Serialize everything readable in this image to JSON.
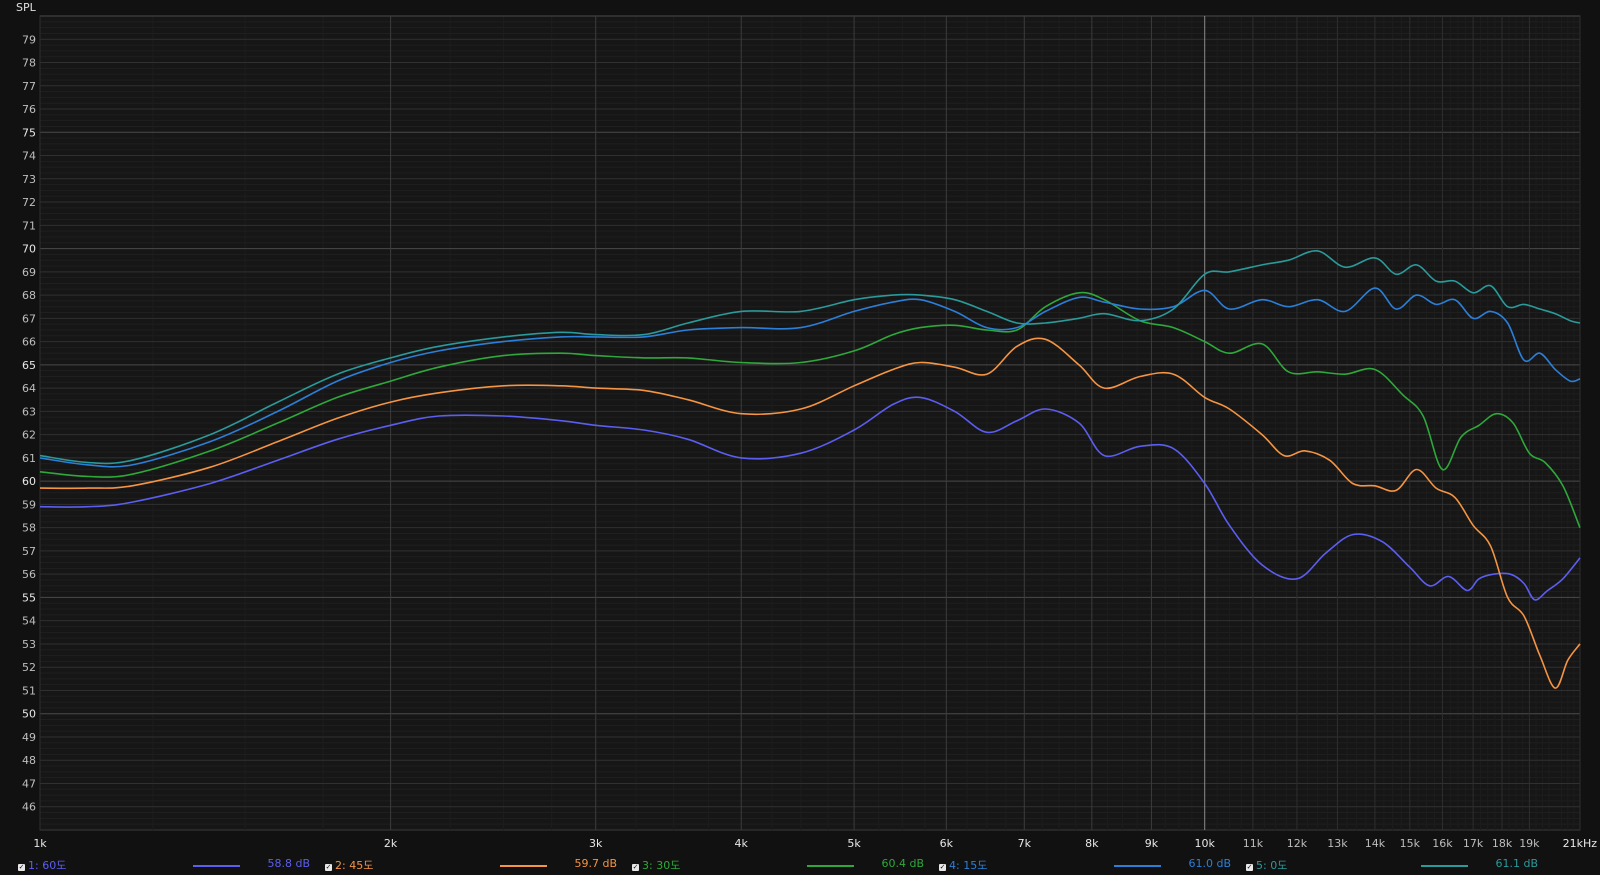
{
  "chart_data": {
    "type": "line",
    "ylabel": "SPL",
    "ylim": [
      45,
      80
    ],
    "xlim": [
      1000,
      21000
    ],
    "x_scale": "log",
    "grid": true,
    "yticks": [
      46,
      47,
      48,
      49,
      50,
      51,
      52,
      53,
      54,
      55,
      56,
      57,
      58,
      59,
      60,
      61,
      62,
      63,
      64,
      65,
      66,
      67,
      68,
      69,
      70,
      71,
      72,
      73,
      74,
      75,
      76,
      77,
      78,
      79
    ],
    "ytick_labels": [
      "46",
      "47",
      "48",
      "49",
      "50",
      "51",
      "52",
      "53",
      "54",
      "55",
      "56",
      "57",
      "58",
      "59",
      "60",
      "61",
      "62",
      "63",
      "64",
      "65",
      "66",
      "67",
      "68",
      "69",
      "70",
      "71",
      "72",
      "73",
      "74",
      "75",
      "76",
      "77",
      "78",
      "79"
    ],
    "xticks": [
      1000,
      2000,
      3000,
      4000,
      5000,
      6000,
      7000,
      8000,
      9000,
      10000,
      11000,
      12000,
      13000,
      14000,
      15000,
      16000,
      17000,
      18000,
      19000,
      21000
    ],
    "xtick_labels": [
      "1k",
      "2k",
      "3k",
      "4k",
      "5k",
      "6k",
      "7k",
      "8k",
      "9k",
      "10k",
      "11k",
      "12k",
      "13k",
      "14k",
      "15k",
      "16k",
      "17k",
      "18k",
      "19k",
      "21kHz"
    ],
    "series": [
      {
        "name": "1: 60도",
        "avg": "58.8 dB",
        "color": "#5b5ef0",
        "x": [
          1000,
          1100,
          1200,
          1400,
          1600,
          1800,
          2000,
          2200,
          2500,
          2800,
          3000,
          3300,
          3600,
          4000,
          4500,
          5000,
          5400,
          5700,
          6100,
          6500,
          6900,
          7300,
          7800,
          8200,
          8800,
          9400,
          10000,
          10500,
          11200,
          12000,
          12700,
          13400,
          14200,
          15000,
          15600,
          16200,
          16800,
          17200,
          17700,
          18300,
          18800,
          19200,
          19700,
          20300,
          21000
        ],
        "y": [
          58.9,
          58.9,
          59.1,
          59.9,
          60.9,
          61.8,
          62.4,
          62.8,
          62.8,
          62.6,
          62.4,
          62.2,
          61.8,
          61.0,
          61.2,
          62.2,
          63.3,
          63.6,
          63.0,
          62.1,
          62.6,
          63.1,
          62.5,
          61.1,
          61.5,
          61.4,
          59.9,
          58.1,
          56.4,
          55.8,
          56.9,
          57.7,
          57.4,
          56.3,
          55.5,
          55.9,
          55.3,
          55.8,
          56.0,
          56.0,
          55.6,
          54.9,
          55.3,
          55.8,
          56.7
        ]
      },
      {
        "name": "2: 45도",
        "avg": "59.7 dB",
        "color": "#f59442",
        "x": [
          1000,
          1100,
          1200,
          1400,
          1600,
          1800,
          2000,
          2200,
          2500,
          2800,
          3000,
          3300,
          3600,
          4000,
          4500,
          5000,
          5400,
          5700,
          6100,
          6500,
          6900,
          7300,
          7800,
          8200,
          8800,
          9400,
          10000,
          10500,
          11200,
          11700,
          12200,
          12800,
          13400,
          14000,
          14600,
          15200,
          15800,
          16400,
          17000,
          17600,
          18200,
          18800,
          19400,
          20000,
          20500,
          21000
        ],
        "y": [
          59.7,
          59.7,
          59.8,
          60.6,
          61.7,
          62.7,
          63.4,
          63.8,
          64.1,
          64.1,
          64.0,
          63.9,
          63.5,
          62.9,
          63.1,
          64.1,
          64.8,
          65.1,
          64.9,
          64.6,
          65.8,
          66.1,
          65.0,
          64.0,
          64.5,
          64.6,
          63.6,
          63.1,
          62.0,
          61.1,
          61.3,
          60.9,
          59.9,
          59.8,
          59.6,
          60.5,
          59.7,
          59.3,
          58.1,
          57.2,
          55.0,
          54.2,
          52.5,
          51.1,
          52.3,
          53.0
        ]
      },
      {
        "name": "3: 30도",
        "avg": "60.4 dB",
        "color": "#2ea83a",
        "x": [
          1000,
          1100,
          1200,
          1400,
          1600,
          1800,
          2000,
          2200,
          2500,
          2800,
          3000,
          3300,
          3600,
          4000,
          4500,
          5000,
          5400,
          5700,
          6100,
          6500,
          6900,
          7300,
          7800,
          8200,
          8800,
          9400,
          10000,
          10500,
          11200,
          11800,
          12500,
          13200,
          14000,
          14800,
          15400,
          16000,
          16600,
          17200,
          17800,
          18400,
          19000,
          19600,
          20300,
          21000
        ],
        "y": [
          60.4,
          60.2,
          60.3,
          61.3,
          62.5,
          63.6,
          64.3,
          64.9,
          65.4,
          65.5,
          65.4,
          65.3,
          65.3,
          65.1,
          65.1,
          65.6,
          66.3,
          66.6,
          66.7,
          66.5,
          66.5,
          67.5,
          68.1,
          67.8,
          66.9,
          66.6,
          66.0,
          65.5,
          65.9,
          64.7,
          64.7,
          64.6,
          64.8,
          63.7,
          62.8,
          60.5,
          61.9,
          62.4,
          62.9,
          62.5,
          61.2,
          60.8,
          59.8,
          58.0
        ]
      },
      {
        "name": "4: 15도",
        "avg": "61.0 dB",
        "color": "#2b7fd8",
        "x": [
          1000,
          1100,
          1200,
          1400,
          1600,
          1800,
          2000,
          2200,
          2500,
          2800,
          3000,
          3300,
          3600,
          4000,
          4500,
          5000,
          5400,
          5700,
          6100,
          6500,
          6900,
          7300,
          7800,
          8200,
          8800,
          9400,
          10000,
          10500,
          11200,
          11800,
          12500,
          13200,
          14000,
          14600,
          15200,
          15800,
          16400,
          17000,
          17600,
          18200,
          18800,
          19400,
          20000,
          20600,
          21000
        ],
        "y": [
          61.0,
          60.7,
          60.7,
          61.7,
          63.0,
          64.3,
          65.1,
          65.6,
          66.0,
          66.2,
          66.2,
          66.2,
          66.5,
          66.6,
          66.6,
          67.3,
          67.7,
          67.8,
          67.3,
          66.6,
          66.6,
          67.3,
          67.9,
          67.7,
          67.4,
          67.5,
          68.2,
          67.4,
          67.8,
          67.5,
          67.8,
          67.3,
          68.3,
          67.4,
          68.0,
          67.6,
          67.8,
          67.0,
          67.3,
          66.8,
          65.2,
          65.5,
          64.8,
          64.3,
          64.4
        ]
      },
      {
        "name": "5: 0도",
        "avg": "61.1 dB",
        "color": "#2a9a9a",
        "x": [
          1000,
          1100,
          1200,
          1400,
          1600,
          1800,
          2000,
          2200,
          2500,
          2800,
          3000,
          3300,
          3600,
          4000,
          4500,
          5000,
          5400,
          5700,
          6100,
          6500,
          6900,
          7300,
          7800,
          8200,
          8800,
          9400,
          10000,
          10500,
          11200,
          11800,
          12500,
          13200,
          14000,
          14600,
          15200,
          15800,
          16400,
          17000,
          17600,
          18200,
          18800,
          19400,
          20000,
          20600,
          21000
        ],
        "y": [
          61.1,
          60.8,
          60.9,
          62.0,
          63.4,
          64.6,
          65.3,
          65.8,
          66.2,
          66.4,
          66.3,
          66.3,
          66.8,
          67.3,
          67.3,
          67.8,
          68.0,
          68.0,
          67.8,
          67.3,
          66.8,
          66.8,
          67.0,
          67.2,
          66.9,
          67.4,
          68.9,
          69.0,
          69.3,
          69.5,
          69.9,
          69.2,
          69.6,
          68.9,
          69.3,
          68.6,
          68.6,
          68.1,
          68.4,
          67.5,
          67.6,
          67.4,
          67.2,
          66.9,
          66.8
        ]
      }
    ]
  }
}
